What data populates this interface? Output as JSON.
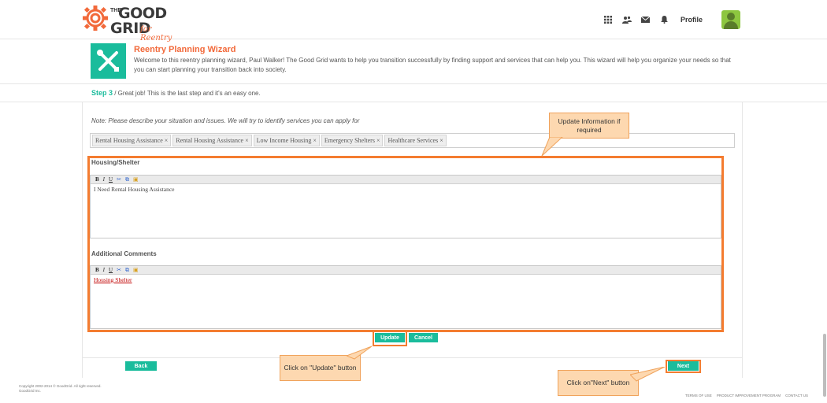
{
  "brand": {
    "the": "THE",
    "good": "GOOD",
    "grid": "GRID",
    "subtitle": "for Reentry"
  },
  "nav": {
    "profile_label": "Profile",
    "icons": [
      "grid-icon",
      "users-icon",
      "mail-icon",
      "bell-icon"
    ]
  },
  "wizard": {
    "title": "Reentry Planning Wizard",
    "intro": "Welcome to this reentry planning wizard, Paul Walker! The Good Grid wants to help you transition successfully by finding support and services that can help you. This wizard will help you organize your needs so that you can start planning your transition back into society."
  },
  "step": {
    "label": "Step 3",
    "text": " / Great job! This is the last step and it's an easy one."
  },
  "note": "Note: Please describe your situation and issues. We will try to identify services you can apply for",
  "tags": [
    "Rental Housing Assistance",
    "Rental Housing Assistance",
    "Low Income Housing",
    "Emergency Shelters",
    "Healthcare Services"
  ],
  "tag_remove": "×",
  "sections": {
    "housing": {
      "label": "Housing/Shelter",
      "content": "I Need Rental Housing Assistance"
    },
    "comments": {
      "label": "Additional Comments",
      "content": "Housing Shelter"
    }
  },
  "toolbar": {
    "bold": "B",
    "italic": "I",
    "underline": "U",
    "cut": "✂",
    "copy": "⧉",
    "paste": "📋"
  },
  "buttons": {
    "update": "Update",
    "cancel": "Cancel",
    "back": "Back",
    "next": "Next"
  },
  "callouts": {
    "update_info": "Update Information if required",
    "click_update": "Click on \"Update\" button",
    "click_next": "Click on\"Next\" button"
  },
  "footer": {
    "copyright": "Copyright 2002-2014 © GoodGrid. All right reserved.",
    "company": "GoodGrid Inc.",
    "links": [
      "TERMS OF USE",
      "PRODUCT IMPROVEMENT PROGRAM",
      "CONTACT US"
    ]
  },
  "colors": {
    "accent": "#1abc9c",
    "brand_orange": "#f2693a",
    "highlight": "#f47c30",
    "callout_bg": "#fdd8b0"
  }
}
